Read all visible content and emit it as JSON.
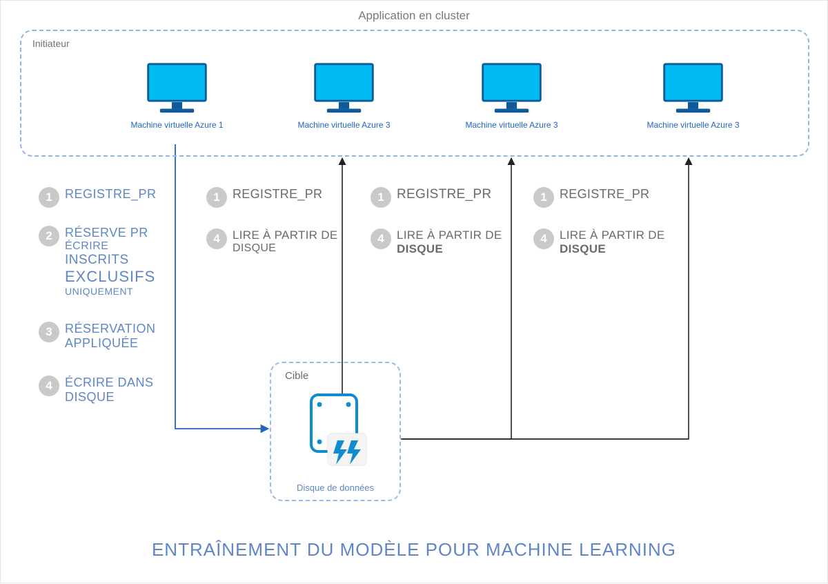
{
  "app_title": "Application en cluster",
  "initiator_label": "Initiateur",
  "vms": [
    {
      "label": "Machine virtuelle Azure 1"
    },
    {
      "label": "Machine virtuelle Azure 3"
    },
    {
      "label": "Machine virtuelle Azure 3"
    },
    {
      "label": "Machine virtuelle Azure 3"
    }
  ],
  "col1_steps": {
    "s1": "REGISTRE_PR",
    "s2_title": "RÉSERVE PR",
    "s2_line2": "ÉCRIRE",
    "s2_line3": "INSCRITS",
    "s2_line4": "EXCLUSIFS",
    "s2_line5": "UNIQUEMENT",
    "s3_title": "RÉSERVATION",
    "s3_line2": "APPLIQUÉE",
    "s4_title": "ÉCRIRE DANS",
    "s4_line2": "DISQUE"
  },
  "other_cols": {
    "c2": {
      "s1": "REGISTRE_PR",
      "s4_line1": "LIRE À PARTIR DE",
      "s4_line2": "DISQUE"
    },
    "c3": {
      "s1": "REGISTRE_PR",
      "s4_line1": "LIRE À PARTIR DE",
      "s4_line2": "DISQUE"
    },
    "c4": {
      "s1": "REGISTRE_PR",
      "s4_line1": "LIRE À PARTIR DE",
      "s4_line2": "DISQUE"
    }
  },
  "badge_nums": {
    "n1": "1",
    "n2": "2",
    "n3": "3",
    "n4": "4"
  },
  "cible_label": "Cible",
  "disk_label": "Disque de données",
  "bottom_title": "ENTRAÎNEMENT DU MODÈLE POUR MACHINE LEARNING",
  "colors": {
    "accent_blue": "#00bcf2",
    "label_blue": "#5f86c6",
    "gray_text": "#6a6a6a"
  }
}
